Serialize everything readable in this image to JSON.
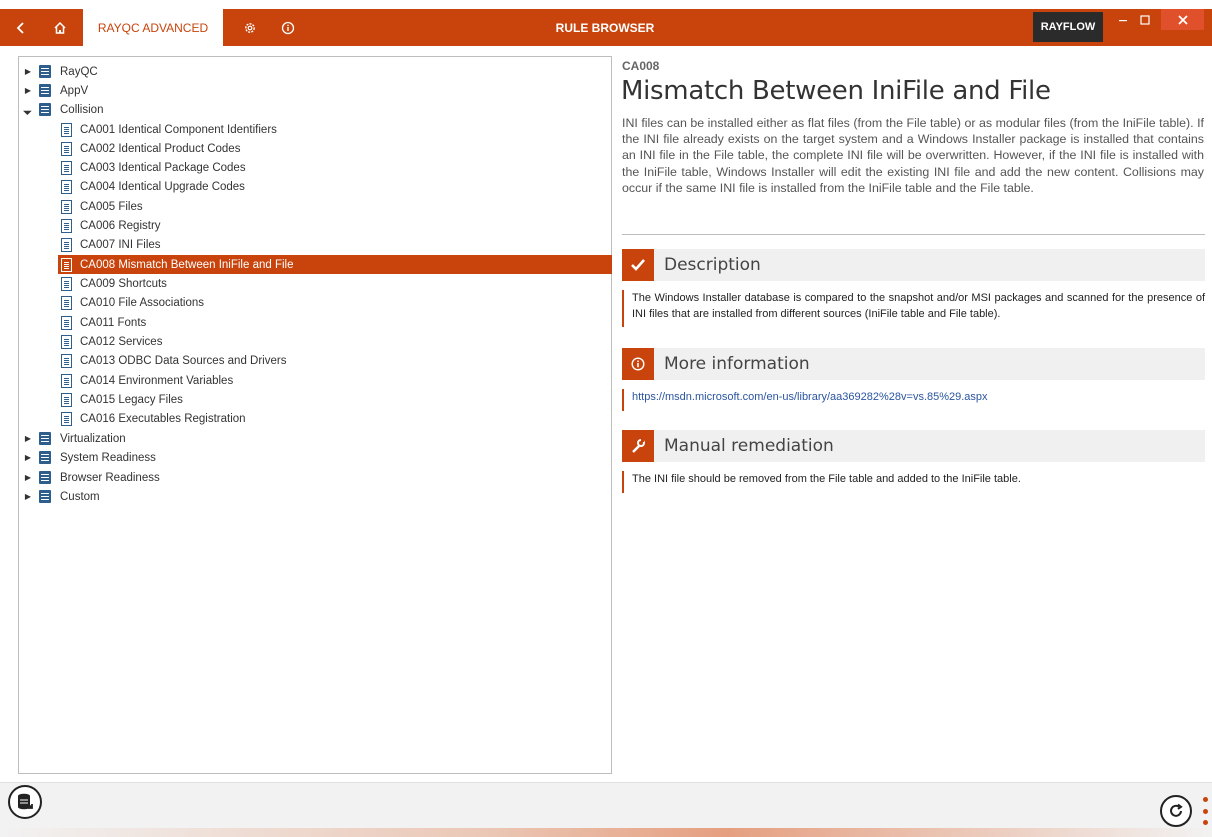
{
  "titlebar": {
    "tab_label": "RAYQC ADVANCED",
    "window_title": "RULE BROWSER",
    "rayflow_label": "RAYFLOW",
    "accent_color": "#c8440c"
  },
  "tree": {
    "items": [
      {
        "label": "RayQC",
        "kind": "folder",
        "expand": "collapsed",
        "level": 0
      },
      {
        "label": "AppV",
        "kind": "folder",
        "expand": "collapsed",
        "level": 0
      },
      {
        "label": "Collision",
        "kind": "folder",
        "expand": "expanded",
        "level": 0
      },
      {
        "label": "CA001 Identical Component Identifiers",
        "kind": "doc",
        "level": 1
      },
      {
        "label": "CA002 Identical Product Codes",
        "kind": "doc",
        "level": 1
      },
      {
        "label": "CA003 Identical Package Codes",
        "kind": "doc",
        "level": 1
      },
      {
        "label": "CA004 Identical Upgrade Codes",
        "kind": "doc",
        "level": 1
      },
      {
        "label": "CA005 Files",
        "kind": "doc",
        "level": 1
      },
      {
        "label": "CA006 Registry",
        "kind": "doc",
        "level": 1
      },
      {
        "label": "CA007 INI Files",
        "kind": "doc",
        "level": 1
      },
      {
        "label": "CA008 Mismatch Between IniFile and File",
        "kind": "doc",
        "level": 1,
        "selected": true
      },
      {
        "label": "CA009 Shortcuts",
        "kind": "doc",
        "level": 1
      },
      {
        "label": "CA010 File Associations",
        "kind": "doc",
        "level": 1
      },
      {
        "label": "CA011 Fonts",
        "kind": "doc",
        "level": 1
      },
      {
        "label": "CA012 Services",
        "kind": "doc",
        "level": 1
      },
      {
        "label": "CA013 ODBC Data Sources and Drivers",
        "kind": "doc",
        "level": 1
      },
      {
        "label": "CA014 Environment Variables",
        "kind": "doc",
        "level": 1
      },
      {
        "label": "CA015 Legacy Files",
        "kind": "doc",
        "level": 1
      },
      {
        "label": "CA016 Executables Registration",
        "kind": "doc",
        "level": 1
      },
      {
        "label": "Virtualization",
        "kind": "folder",
        "expand": "collapsed",
        "level": 0
      },
      {
        "label": "System Readiness",
        "kind": "folder",
        "expand": "collapsed",
        "level": 0
      },
      {
        "label": "Browser Readiness",
        "kind": "folder",
        "expand": "collapsed",
        "level": 0
      },
      {
        "label": "Custom",
        "kind": "folder",
        "expand": "collapsed",
        "level": 0
      }
    ]
  },
  "rule": {
    "code": "CA008",
    "title": "Mismatch Between IniFile and File",
    "intro": "INI files can be installed either as flat files (from the File table) or as modular files (from the IniFile table). If the INI file already exists on the target system and a Windows Installer package is installed that contains an INI file in the File table, the complete INI file will be overwritten. However, if the INI file is installed with the IniFile table, Windows Installer will edit the existing INI file and add the new content. Collisions may occur if the same INI file is installed from the IniFile table and the File table."
  },
  "sections": {
    "description": {
      "title": "Description",
      "icon": "check-icon",
      "body": "The Windows Installer database is compared to the snapshot and/or MSI packages and scanned for the presence of INI files that are installed from different sources (IniFile table and File table)."
    },
    "more_info": {
      "title": "More information",
      "icon": "info-icon",
      "link": "https://msdn.microsoft.com/en-us/library/aa369282%28v=vs.85%29.aspx"
    },
    "remediation": {
      "title": "Manual remediation",
      "icon": "wrench-icon",
      "body": "The INI file should be removed from the File table and added to the IniFile table."
    }
  }
}
